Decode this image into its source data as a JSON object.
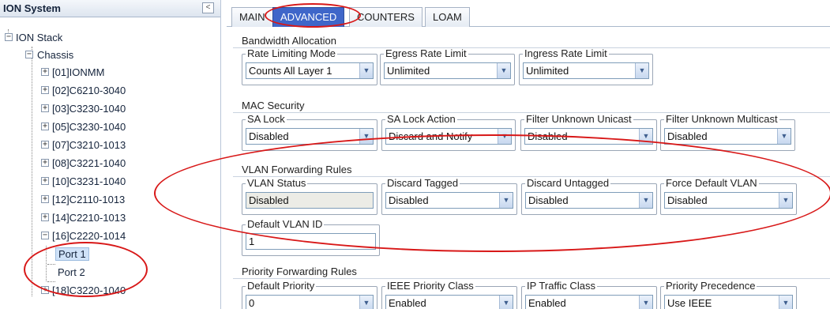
{
  "left_panel": {
    "title": "ION System",
    "collapse_glyph": "<",
    "root": "ION Stack",
    "chassis": "Chassis",
    "modules": [
      "[01]IONMM",
      "[02]C6210-3040",
      "[03]C3230-1040",
      "[05]C3230-1040",
      "[07]C3210-1013",
      "[08]C3221-1040",
      "[10]C3231-1040",
      "[12]C2110-1013",
      "[14]C2210-1013"
    ],
    "expanded_module": "[16]C2220-1014",
    "ports": [
      "Port 1",
      "Port 2"
    ],
    "last_module": "[18]C3220-1040",
    "icons": {
      "plus": "+",
      "minus": "−"
    }
  },
  "tabs": [
    "MAIN",
    "ADVANCED",
    "COUNTERS",
    "LOAM"
  ],
  "active_tab": "ADVANCED",
  "sections": {
    "bandwidth": {
      "title": "Bandwidth Allocation",
      "fields": [
        {
          "label": "Rate Limiting Mode",
          "value": "Counts All Layer 1"
        },
        {
          "label": "Egress Rate Limit",
          "value": "Unlimited"
        },
        {
          "label": "Ingress Rate Limit",
          "value": "Unlimited"
        }
      ]
    },
    "mac": {
      "title": "MAC Security",
      "fields": [
        {
          "label": "SA Lock",
          "value": "Disabled"
        },
        {
          "label": "SA Lock Action",
          "value": "Discard and Notify"
        },
        {
          "label": "Filter Unknown Unicast",
          "value": "Disabled"
        },
        {
          "label": "Filter Unknown Multicast",
          "value": "Disabled"
        }
      ]
    },
    "vlan": {
      "title": "VLAN Forwarding Rules",
      "fields": [
        {
          "label": "VLAN Status",
          "value": "Disabled"
        },
        {
          "label": "Discard Tagged",
          "value": "Disabled"
        },
        {
          "label": "Discard Untagged",
          "value": "Disabled"
        },
        {
          "label": "Force Default VLAN",
          "value": "Disabled"
        }
      ],
      "default_vlan_label": "Default VLAN ID",
      "default_vlan_value": "1"
    },
    "priority": {
      "title": "Priority Forwarding Rules",
      "fields": [
        {
          "label": "Default Priority",
          "value": "0"
        },
        {
          "label": "IEEE Priority Class",
          "value": "Enabled"
        },
        {
          "label": "IP Traffic Class",
          "value": "Enabled"
        },
        {
          "label": "Priority Precedence",
          "value": "Use IEEE"
        }
      ]
    }
  },
  "dropdown_glyph": "▼",
  "colors": {
    "active_tab": "#3f66c9",
    "annotation": "#d81818"
  }
}
